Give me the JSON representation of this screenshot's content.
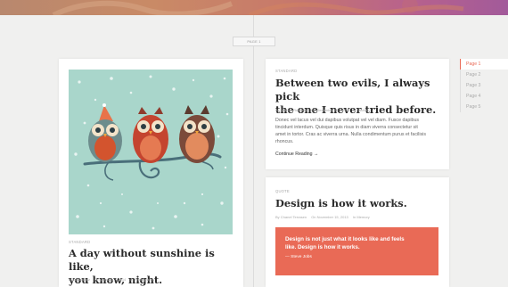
{
  "page_marker": "PAGE 1",
  "posts": [
    {
      "kicker": "STANDARD",
      "title_line1": "A day without sunshine is like,",
      "title_line2": "you know, night.",
      "author": "By Anna Diaz",
      "date": "On January 7, 2014",
      "category": "In Photography"
    },
    {
      "kicker": "STANDARD",
      "title_line1": "Between two evils, I always pick",
      "title_line2": "the one I never tried before.",
      "author": "By Belinda Redfield",
      "date": "On December 29, 2013",
      "category": "In Fashion",
      "excerpt": [
        "Donec vel lacus vel dui dapibus volutpat vel vel diam. Fusce dapibus",
        "tincidunt interdum. Quisque quis risus in diam viverra consectetur sit",
        "amet in tortor. Cras ac viverra urna. Nulla condimentum purus et facilisis",
        "rhoncus."
      ],
      "more": "Continue Reading →"
    },
    {
      "kicker": "QUOTE",
      "title": "Design is how it works.",
      "author": "By Chanel Terrasen",
      "date": "On November 15, 2013",
      "category": "In Memory",
      "quote_line1": "Design is not just what it looks like and feels",
      "quote_line2": "like. Design is how it works.",
      "quote_author": "— Steve Jobs"
    }
  ],
  "pagination": [
    "Page 1",
    "Page 2",
    "Page 3",
    "Page 4",
    "Page 5"
  ],
  "colors": {
    "accent": "#e96a56",
    "image_bg": "#a9d6cb"
  }
}
